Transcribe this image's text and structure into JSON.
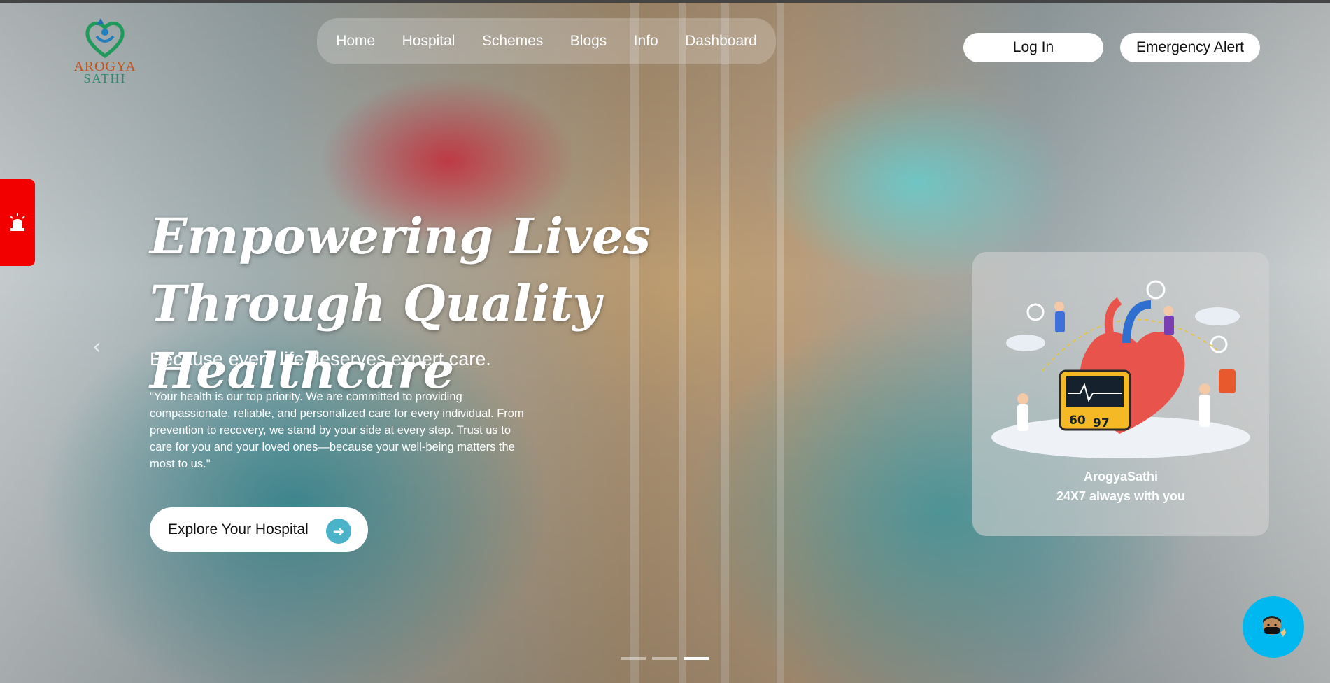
{
  "brand": {
    "logo_line1": "AROGYA",
    "logo_line2": "SATHI"
  },
  "nav": {
    "items": [
      "Home",
      "Hospital",
      "Schemes",
      "Blogs",
      "Info",
      "Dashboard"
    ]
  },
  "header_actions": {
    "login_label": "Log In",
    "emergency_label": "Emergency Alert"
  },
  "hero": {
    "headline_line1": "Empowering Lives",
    "headline_line2": "Through Quality Healthcare",
    "subheading": "Because every life deserves expert care.",
    "paragraph": "\"Your health is our top priority. We are committed to providing compassionate, reliable, and personalized care for every individual. From prevention to recovery, we stand by your side at every step. Trust us to care for you and your loved ones—because your well-being matters the most to us.\"",
    "cta_label": "Explore Your Hospital"
  },
  "card": {
    "monitor_value1": "60",
    "monitor_value2": "97",
    "title": "ArogyaSathi",
    "tagline": "24X7 always with you"
  },
  "carousel": {
    "slide_count": 3,
    "active_index": 2
  },
  "icons": {
    "alarm": "siren-icon",
    "prev": "chevron-left-icon",
    "cta_arrow": "arrow-right-icon",
    "chat": "chatbot-avatar-icon"
  },
  "colors": {
    "alarm_red": "#f20000",
    "chat_blue": "#00b8f0",
    "cta_arrow": "#4ab3c9"
  }
}
